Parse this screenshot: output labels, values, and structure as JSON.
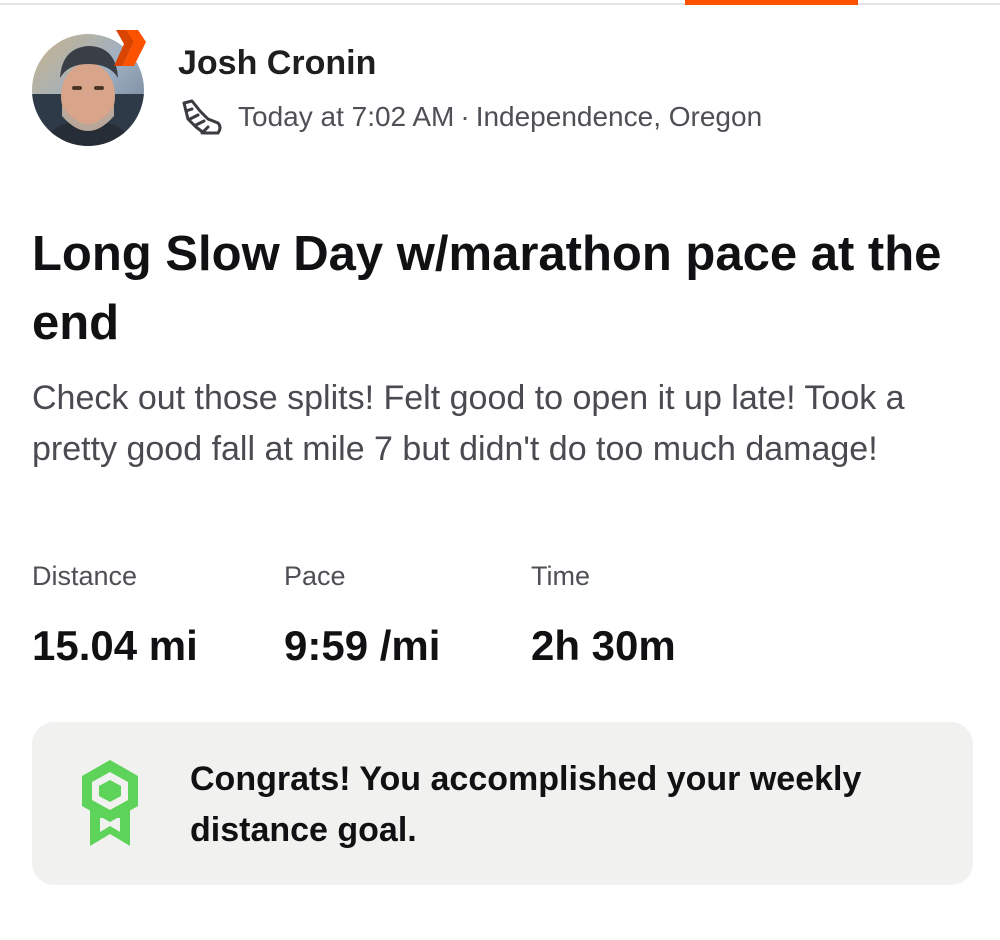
{
  "colors": {
    "accent": "#fc5200",
    "goal_green": "#5ed35a",
    "card_background": "#f1f1f0"
  },
  "header": {
    "athlete_name": "Josh Cronin",
    "activity_icon": "running-shoe-icon",
    "timestamp": "Today at 7:02 AM",
    "separator": "·",
    "location": "Independence, Oregon"
  },
  "activity": {
    "title": "Long Slow Day w/marathon pace at the end",
    "description": "Check out those splits! Felt good to open it up late! Took a pretty good fall at mile 7 but didn't do too much damage!"
  },
  "stats": {
    "distance": {
      "label": "Distance",
      "value": "15.04 mi"
    },
    "pace": {
      "label": "Pace",
      "value": "9:59 /mi"
    },
    "time": {
      "label": "Time",
      "value": "2h 30m"
    }
  },
  "goal_card": {
    "icon": "achievement-ribbon-icon",
    "message": "Congrats! You accomplished your weekly distance goal."
  }
}
